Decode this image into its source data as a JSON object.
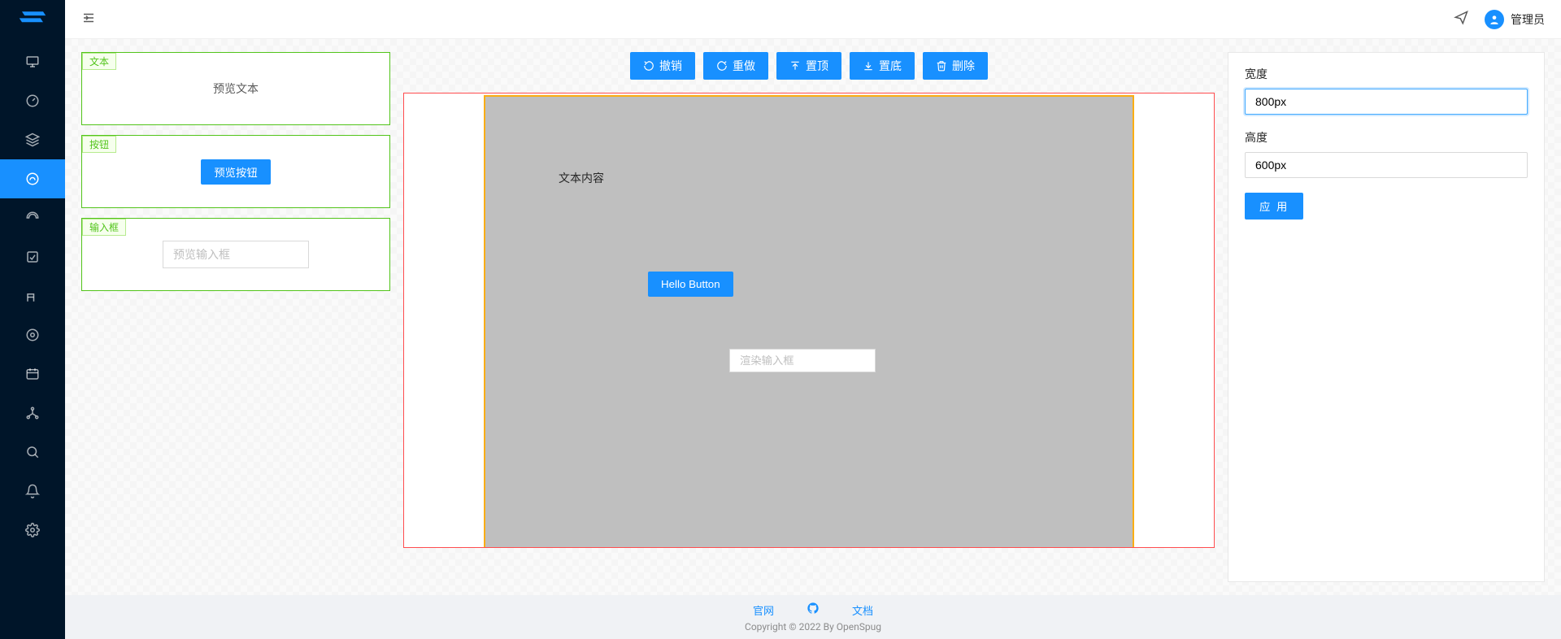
{
  "header": {
    "username": "管理员"
  },
  "palette": {
    "text": {
      "tag": "文本",
      "preview": "预览文本"
    },
    "button": {
      "tag": "按钮",
      "preview": "预览按钮"
    },
    "input": {
      "tag": "输入框",
      "placeholder": "预览输入框"
    }
  },
  "toolbar": {
    "undo": "撤销",
    "redo": "重做",
    "top": "置顶",
    "bottom": "置底",
    "delete": "删除"
  },
  "canvas": {
    "text_content": "文本内容",
    "button_label": "Hello Button",
    "input_placeholder": "渲染输入框"
  },
  "props": {
    "width_label": "宽度",
    "width_value": "800px",
    "height_label": "高度",
    "height_value": "600px",
    "apply_label": "应 用"
  },
  "footer": {
    "link_official": "官网",
    "link_docs": "文档",
    "copyright": "Copyright © 2022 By OpenSpug"
  }
}
